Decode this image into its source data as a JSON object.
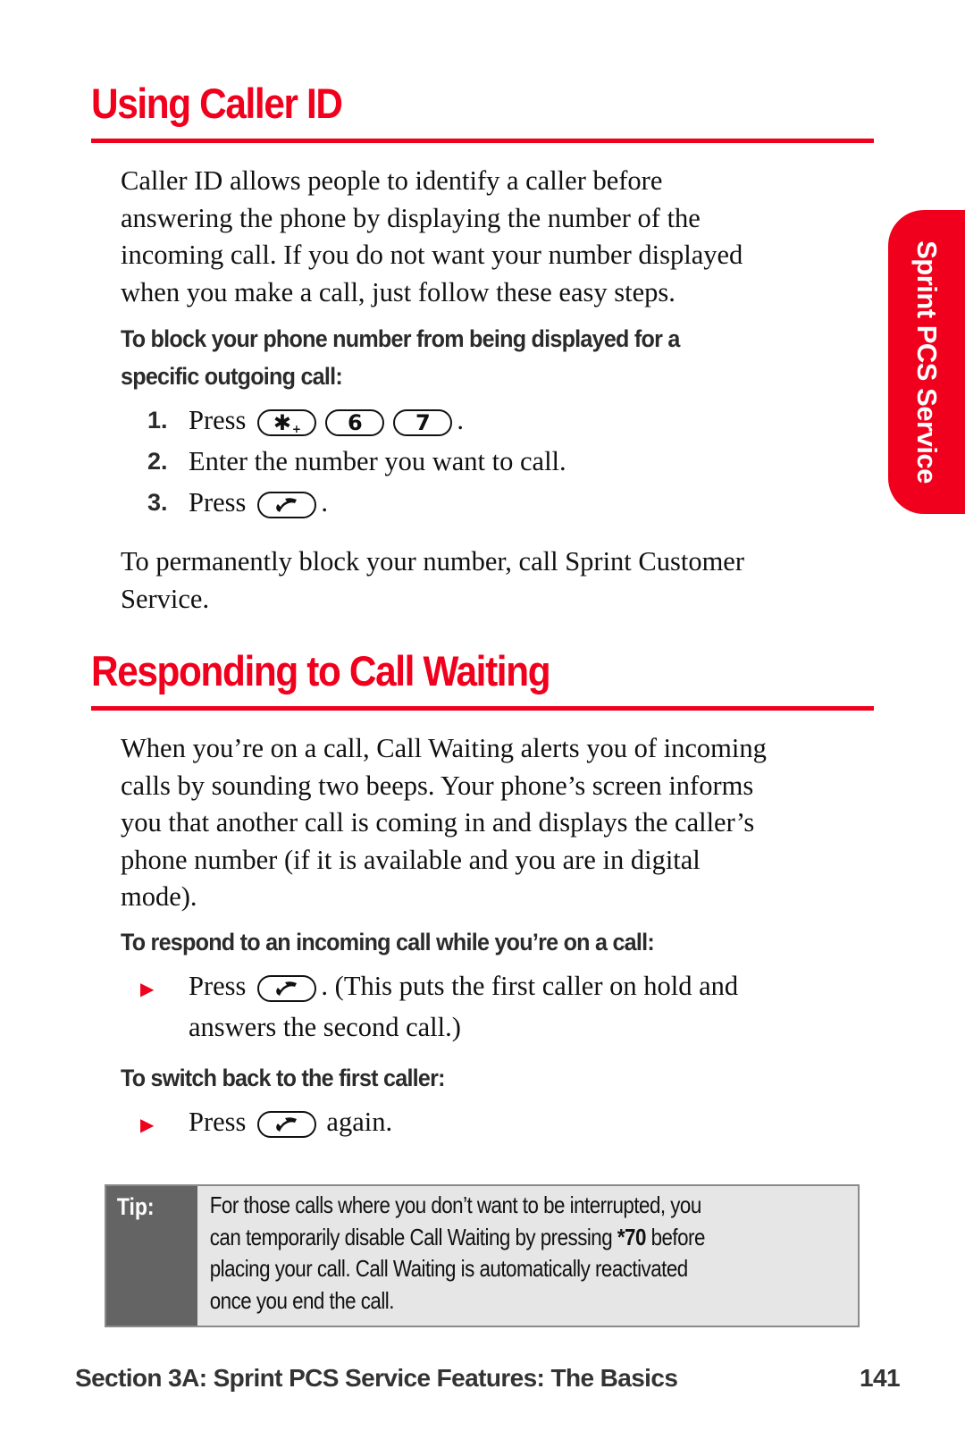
{
  "side_tab": {
    "label": "Sprint PCS Service"
  },
  "colors": {
    "accent": "#f0001c",
    "tip_dark": "#646464",
    "tip_bg": "#e6e6e6"
  },
  "section1": {
    "title": "Using Caller ID",
    "intro_lines": [
      "Caller ID allows people to identify a caller before",
      "answering the phone by displaying the number of the",
      "incoming call. If you do not want your number displayed",
      "when you make a call, just follow these easy steps."
    ],
    "subhead_lines": [
      "To block your phone number from being displayed for a",
      "specific outgoing call:"
    ],
    "steps": [
      {
        "num": "1.",
        "text_before": "Press",
        "keys": [
          {
            "icon": "star-key-icon",
            "label": "✱",
            "sub": "+"
          },
          {
            "icon": "six-key-icon",
            "label": "6",
            "sub": ""
          },
          {
            "icon": "seven-key-icon",
            "label": "7",
            "sub": ""
          }
        ],
        "text_after": "."
      },
      {
        "num": "2.",
        "text": "Enter the number you want to call."
      },
      {
        "num": "3.",
        "text_before": "Press",
        "key_icon": "talk-key-icon",
        "text_after": "."
      }
    ],
    "outro_lines": [
      "To permanently block your number, call Sprint Customer",
      "Service."
    ]
  },
  "section2": {
    "title": "Responding to Call Waiting",
    "intro_lines": [
      "When you’re on a call, Call Waiting alerts you of incoming",
      "calls by sounding two beeps. Your phone’s screen informs",
      "you that another call is coming in and displays the caller’s",
      "phone number (if it is available and you are in digital",
      "mode)."
    ],
    "subhead1": "To respond to an incoming call while you’re on a call:",
    "bullet1": {
      "text_before": "Press",
      "key_icon": "talk-key-icon",
      "text_after": ". (This puts the first caller on hold and",
      "line2": "answers the second call.)"
    },
    "subhead2": "To switch back to the first caller:",
    "bullet2": {
      "text_before": "Press",
      "key_icon": "talk-key-icon",
      "text_after": "again."
    }
  },
  "tip": {
    "label": "Tip:",
    "line1": "For those calls where you don’t want to be interrupted, you",
    "line2_before": "can temporarily disable Call Waiting by pressing ",
    "line2_bold": "*70",
    "line2_after": " before",
    "line3": "placing your call. Call Waiting is automatically reactivated",
    "line4": "once you end the call."
  },
  "footer": {
    "section": "Section 3A: Sprint PCS Service Features: The Basics",
    "page": "141"
  }
}
